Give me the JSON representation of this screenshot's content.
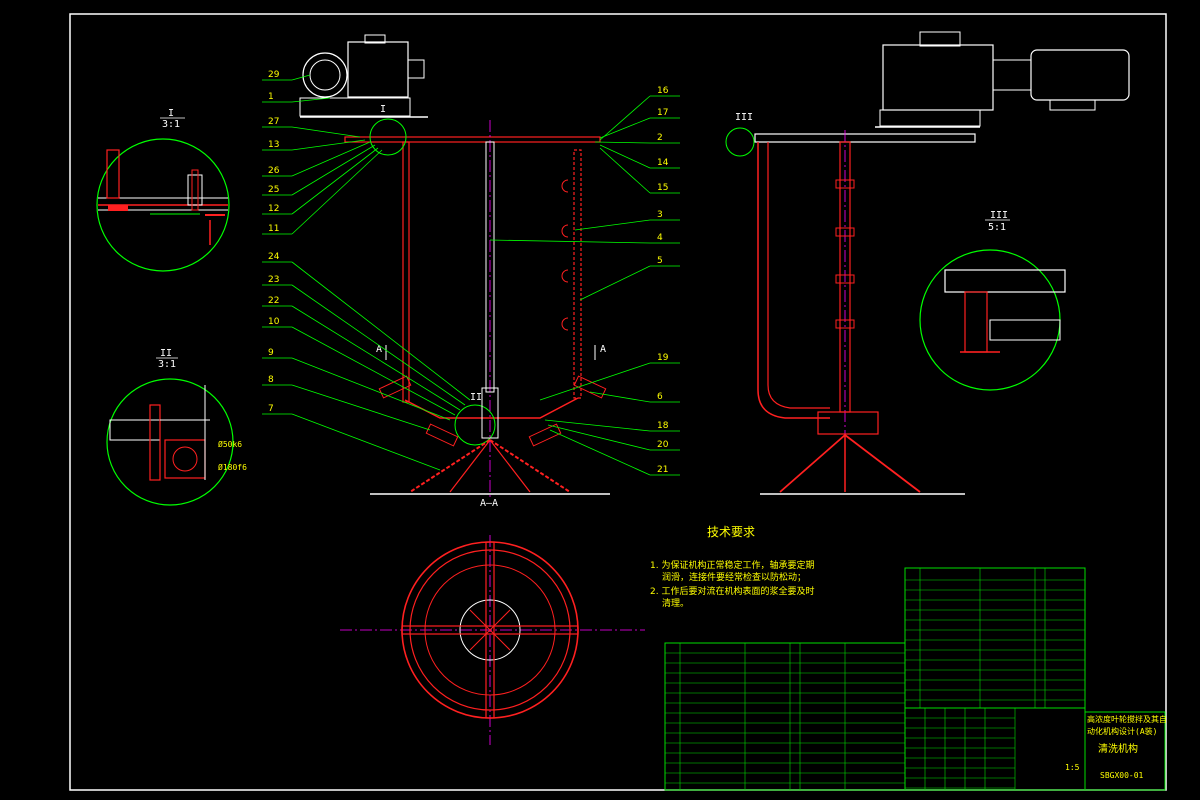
{
  "colors": {
    "background": "#000000",
    "frame": "#ffffff",
    "part_red": "#ff2020",
    "leader_green": "#00ff00",
    "text_yellow": "#ffff00",
    "center_magenta": "#ff00ff",
    "table_green": "#00dd00"
  },
  "views": {
    "section_label": "A—A",
    "cut_mark": "A",
    "detail_I": {
      "name": "I",
      "scale": "3:1"
    },
    "detail_II": {
      "name": "II",
      "scale": "3:1"
    },
    "detail_III": {
      "name": "III",
      "scale": "5:1"
    },
    "dims": {
      "d1": "Ø50k6",
      "d2": "Ø180f6"
    }
  },
  "left_callouts": [
    "29",
    "1",
    "27",
    "13",
    "26",
    "25",
    "12",
    "11",
    "24",
    "23",
    "22",
    "10",
    "9",
    "8",
    "7"
  ],
  "right_callouts": [
    "16",
    "17",
    "2",
    "14",
    "15",
    "3",
    "4",
    "5",
    "19",
    "6",
    "18",
    "20",
    "21"
  ],
  "tech_req": {
    "title": "技术要求",
    "lines": [
      "1. 为保证机构正常稳定工作，轴承要定期",
      "润滑，连接件要经常检查以防松动；",
      "2. 工作后要对流在机构表面的浆全要及时",
      "清理。"
    ]
  },
  "title_block": {
    "project": "高浓度叶轮搅拌及其自",
    "project2": "动化机构设计(A装)",
    "part_name": "清洗机构",
    "drawing_no": "SBGX00-01",
    "scale": "1:5"
  }
}
